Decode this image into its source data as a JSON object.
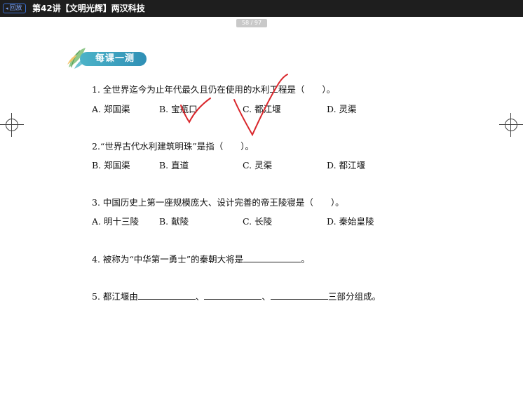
{
  "app": {
    "back_label": "回放",
    "window_title": "第42讲【文明光辉】两汉科技",
    "page_indicator": "58 / 97"
  },
  "worksheet": {
    "section_title": "每课一测",
    "questions": [
      {
        "stem": "1. 全世界迄今为止年代最久且仍在使用的水利工程是（　　）。",
        "options": [
          "A. 郑国渠",
          "B. 宝瓶口",
          "C. 都江堰",
          "D. 灵渠"
        ]
      },
      {
        "stem": "2.“世界古代水利建筑明珠”是指（　　）。",
        "options": [
          "B. 郑国渠",
          "B. 直道",
          "C. 灵渠",
          "D. 都江堰"
        ]
      },
      {
        "stem": "3. 中国历史上第一座规模庞大、设计完善的帝王陵寝是（　　）。",
        "options": [
          "A. 明十三陵",
          "B. 献陵",
          "C. 长陵",
          "D. 秦始皇陵"
        ]
      },
      {
        "stem_before": "4. 被称为“中华第一勇士”的秦朝大将是",
        "stem_after": "。"
      },
      {
        "stem_before": "5. 都江堰由",
        "sep1": "、",
        "sep2": "、",
        "stem_after": "三部分组成。"
      }
    ]
  },
  "colors": {
    "titlebar": "#1e1e1e",
    "banner": "#3aa3c1",
    "annotation": "#d9262b"
  },
  "icons": [
    "back-chevron-icon",
    "leaf-icon",
    "crop-mark-icon",
    "check-mark-icon"
  ]
}
